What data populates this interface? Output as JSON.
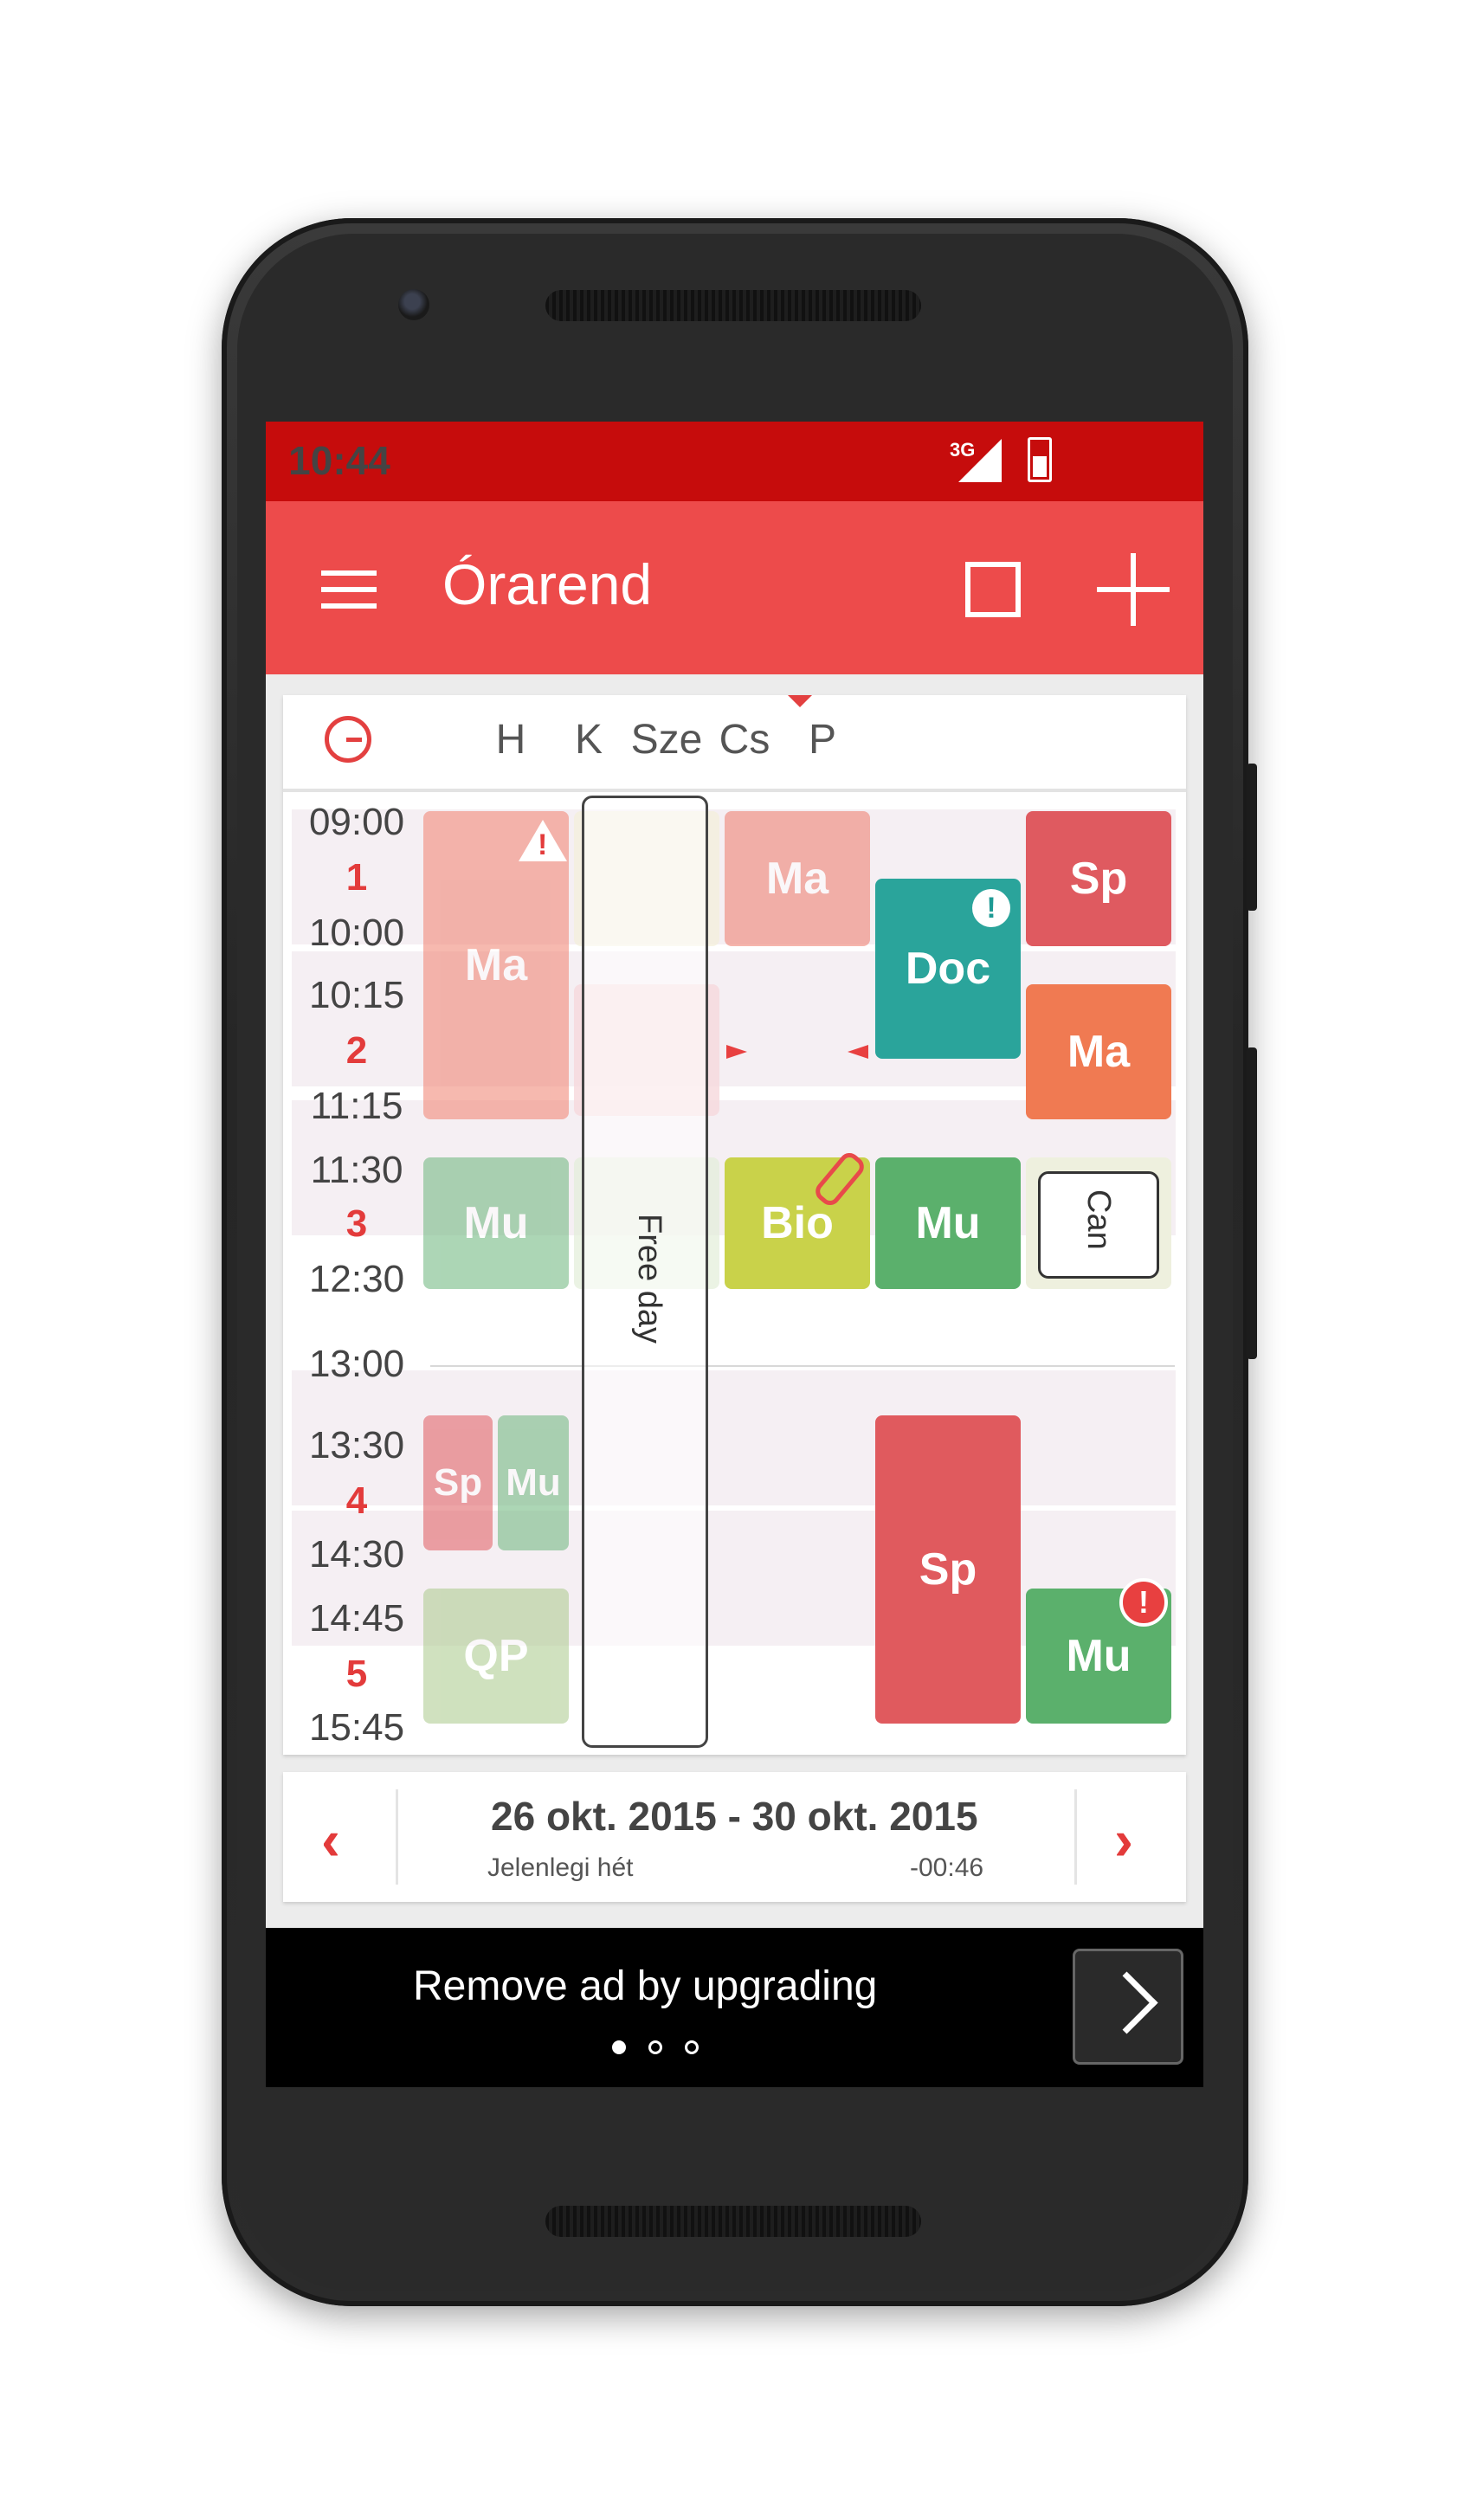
{
  "status": {
    "network": "3G",
    "time": "10:44"
  },
  "app": {
    "title": "Órarend"
  },
  "days": [
    "H",
    "K",
    "Sze",
    "Cs",
    "P"
  ],
  "periods": [
    {
      "start": "09:00",
      "num": "1",
      "end": "10:00"
    },
    {
      "start": "10:15",
      "num": "2",
      "end": "11:15"
    },
    {
      "start": "11:30",
      "num": "3",
      "end": "12:30"
    },
    {
      "start": "13:00"
    },
    {
      "start": "13:30",
      "num": "4",
      "end": "14:30"
    },
    {
      "start": "14:45",
      "num": "5",
      "end": "15:45"
    }
  ],
  "lessons": {
    "h_ma": "Ma",
    "h_mu": "Mu",
    "h_sp": "Sp",
    "h_mu2": "Mu",
    "h_qp": "QP",
    "sze_ma": "Ma",
    "sze_bio": "Bio",
    "cs_doc": "Doc",
    "cs_mu": "Mu",
    "cs_sp": "Sp",
    "p_sp": "Sp",
    "p_ma": "Ma",
    "p_mu": "Mu"
  },
  "free_day": "Free day",
  "cancel": "Can",
  "week": {
    "range": "26 okt. 2015 - 30 okt. 2015",
    "sub": "Jelenlegi hét",
    "diff": "-00:46"
  },
  "ad": {
    "text": "Remove ad by upgrading"
  },
  "colors": {
    "statusbar": "#c60c0c",
    "appbar": "#ed4b4b",
    "accent": "#e33b3b",
    "salmon": "#f0a090",
    "green": "#6ab57a",
    "teal": "#2aa49b",
    "red": "#e05a5e",
    "orange": "#f07a52",
    "lime": "#c9d24a"
  }
}
